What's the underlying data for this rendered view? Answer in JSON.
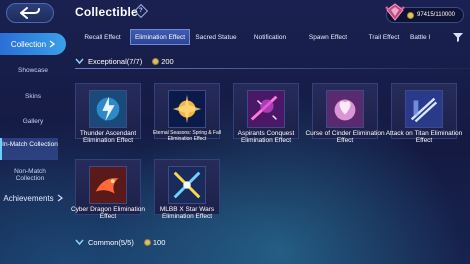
{
  "header": {
    "title": "Collectible",
    "currency": "97415/110000"
  },
  "tabs": [
    {
      "label": "Recall Effect",
      "active": false
    },
    {
      "label": "Elimination Effect",
      "active": true
    },
    {
      "label": "Sacred Statue",
      "active": false
    },
    {
      "label": "Notification",
      "active": false
    },
    {
      "label": "Spawn Effect",
      "active": false
    },
    {
      "label": "Trail Effect",
      "active": false
    },
    {
      "label": "Battle I",
      "active": false
    }
  ],
  "sidebar": {
    "collection": "Collection",
    "showcase": "Showcase",
    "skins": "Skins",
    "gallery": "Gallery",
    "in_match": "In-Match Collection",
    "non_match": "Non-Match Collection",
    "achievements": "Achievements"
  },
  "sections": {
    "exceptional": {
      "label": "Exceptional(7/7)",
      "points": "200"
    },
    "common": {
      "label": "Common(5/5)",
      "points": "100"
    }
  },
  "items": [
    {
      "label": "Thunder Ascendant Elimination Effect"
    },
    {
      "label": "Eternal Seasons: Spring & Fall Elimination Effect"
    },
    {
      "label": "Aspirants Conquest Elimination Effect"
    },
    {
      "label": "Curse of Cinder Elimination Effect"
    },
    {
      "label": "Attack on Titan Elimination Effect"
    },
    {
      "label": "Cyber Dragon Elimination Effect"
    },
    {
      "label": "MLBB X Star Wars Elimination Effect"
    }
  ],
  "colors": {
    "background": "#141a3e",
    "accent": "#3aa0ea",
    "tab_active": "#2d4596"
  }
}
